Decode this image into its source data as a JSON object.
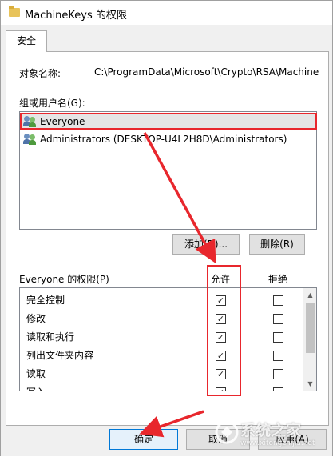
{
  "window": {
    "title": "MachineKeys 的权限",
    "icon": "folder-icon"
  },
  "tabs": [
    {
      "label": "安全",
      "active": true
    }
  ],
  "object": {
    "label": "对象名称:",
    "path": "C:\\ProgramData\\Microsoft\\Crypto\\RSA\\Machine"
  },
  "groups": {
    "label": "组或用户名(G):",
    "items": [
      {
        "name": "Everyone",
        "selected": true
      },
      {
        "name": "Administrators (DESKTOP-U4L2H8D\\Administrators)",
        "selected": false
      }
    ],
    "add_button": "添加(D)...",
    "remove_button": "删除(R)"
  },
  "permissions": {
    "label": "Everyone 的权限(P)",
    "allow_header": "允许",
    "deny_header": "拒绝",
    "rows": [
      {
        "name": "完全控制",
        "allow": true,
        "deny": false
      },
      {
        "name": "修改",
        "allow": true,
        "deny": false
      },
      {
        "name": "读取和执行",
        "allow": true,
        "deny": false
      },
      {
        "name": "列出文件夹内容",
        "allow": true,
        "deny": false
      },
      {
        "name": "读取",
        "allow": true,
        "deny": false
      },
      {
        "name": "写入",
        "allow": true,
        "deny": false
      }
    ]
  },
  "footer": {
    "ok_button": "确定",
    "cancel_button": "取消",
    "apply_button": "应用(A)"
  },
  "watermark": {
    "text": "系统之家",
    "url": "www.xitongzhijia.net"
  },
  "colors": {
    "highlight": "#e8272d",
    "panel": "#ffffff",
    "window": "#f0f0f0"
  }
}
